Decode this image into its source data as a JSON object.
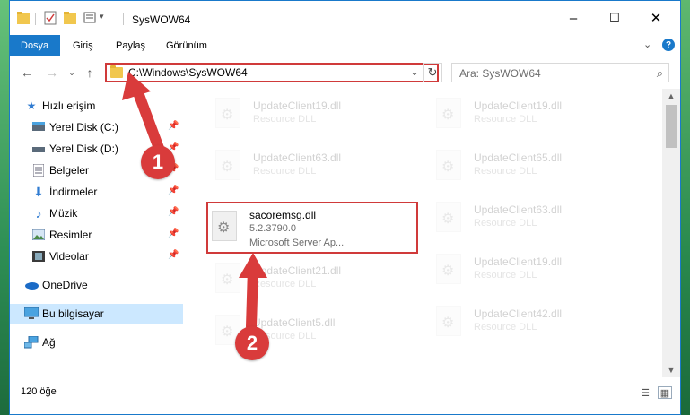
{
  "window": {
    "title": "SysWOW64",
    "minimize": "–",
    "maximize": "☐",
    "close": "✕"
  },
  "ribbon": {
    "tabs": [
      "Dosya",
      "Giriş",
      "Paylaş",
      "Görünüm"
    ],
    "expand": "⌄",
    "help": "?"
  },
  "address": {
    "path": "C:\\Windows\\SysWOW64",
    "dropdown": "⌄",
    "refresh": "↻",
    "search_placeholder": "Ara: SysWOW64"
  },
  "nav": {
    "items": [
      {
        "label": "Hızlı erişim",
        "icon": "star-icon"
      },
      {
        "label": "Yerel Disk (C:)",
        "icon": "drive-icon",
        "pinned": true
      },
      {
        "label": "Yerel Disk (D:)",
        "icon": "drive-icon",
        "pinned": true
      },
      {
        "label": "Belgeler",
        "icon": "documents-icon",
        "pinned": true
      },
      {
        "label": "İndirmeler",
        "icon": "download-icon",
        "pinned": true
      },
      {
        "label": "Müzik",
        "icon": "music-icon",
        "pinned": true
      },
      {
        "label": "Resimler",
        "icon": "pictures-icon",
        "pinned": true
      },
      {
        "label": "Videolar",
        "icon": "videos-icon",
        "pinned": true
      },
      {
        "label": "OneDrive",
        "icon": "onedrive-icon"
      },
      {
        "label": "Bu bilgisayar",
        "icon": "computer-icon",
        "selected": true
      },
      {
        "label": "Ağ",
        "icon": "network-icon"
      }
    ]
  },
  "files": {
    "left": [
      {
        "name": "UpdateClient19.dll",
        "type": "Resource DLL"
      },
      {
        "name": "UpdateClient63.dll",
        "type": "Resource DLL"
      },
      {
        "name": "sacoremsg.dll",
        "type": "5.2.3790.0",
        "desc": "Microsoft Server Ap..."
      },
      {
        "name": "UpdateClient21.dll",
        "type": "Resource DLL"
      },
      {
        "name": "UpdateClient5.dll",
        "type": "Resource DLL"
      }
    ],
    "right": [
      {
        "name": "UpdateClient19.dll",
        "type": "Resource DLL"
      },
      {
        "name": "UpdateClient65.dll",
        "type": "Resource DLL"
      },
      {
        "name": "UpdateClient63.dll",
        "type": "Resource DLL"
      },
      {
        "name": "UpdateClient19.dll",
        "type": "Resource DLL"
      },
      {
        "name": "UpdateClient42.dll",
        "type": "Resource DLL"
      }
    ]
  },
  "status": {
    "count": "120 öğe"
  },
  "annotations": {
    "step1": "1",
    "step2": "2",
    "color": "#d93b3b"
  }
}
